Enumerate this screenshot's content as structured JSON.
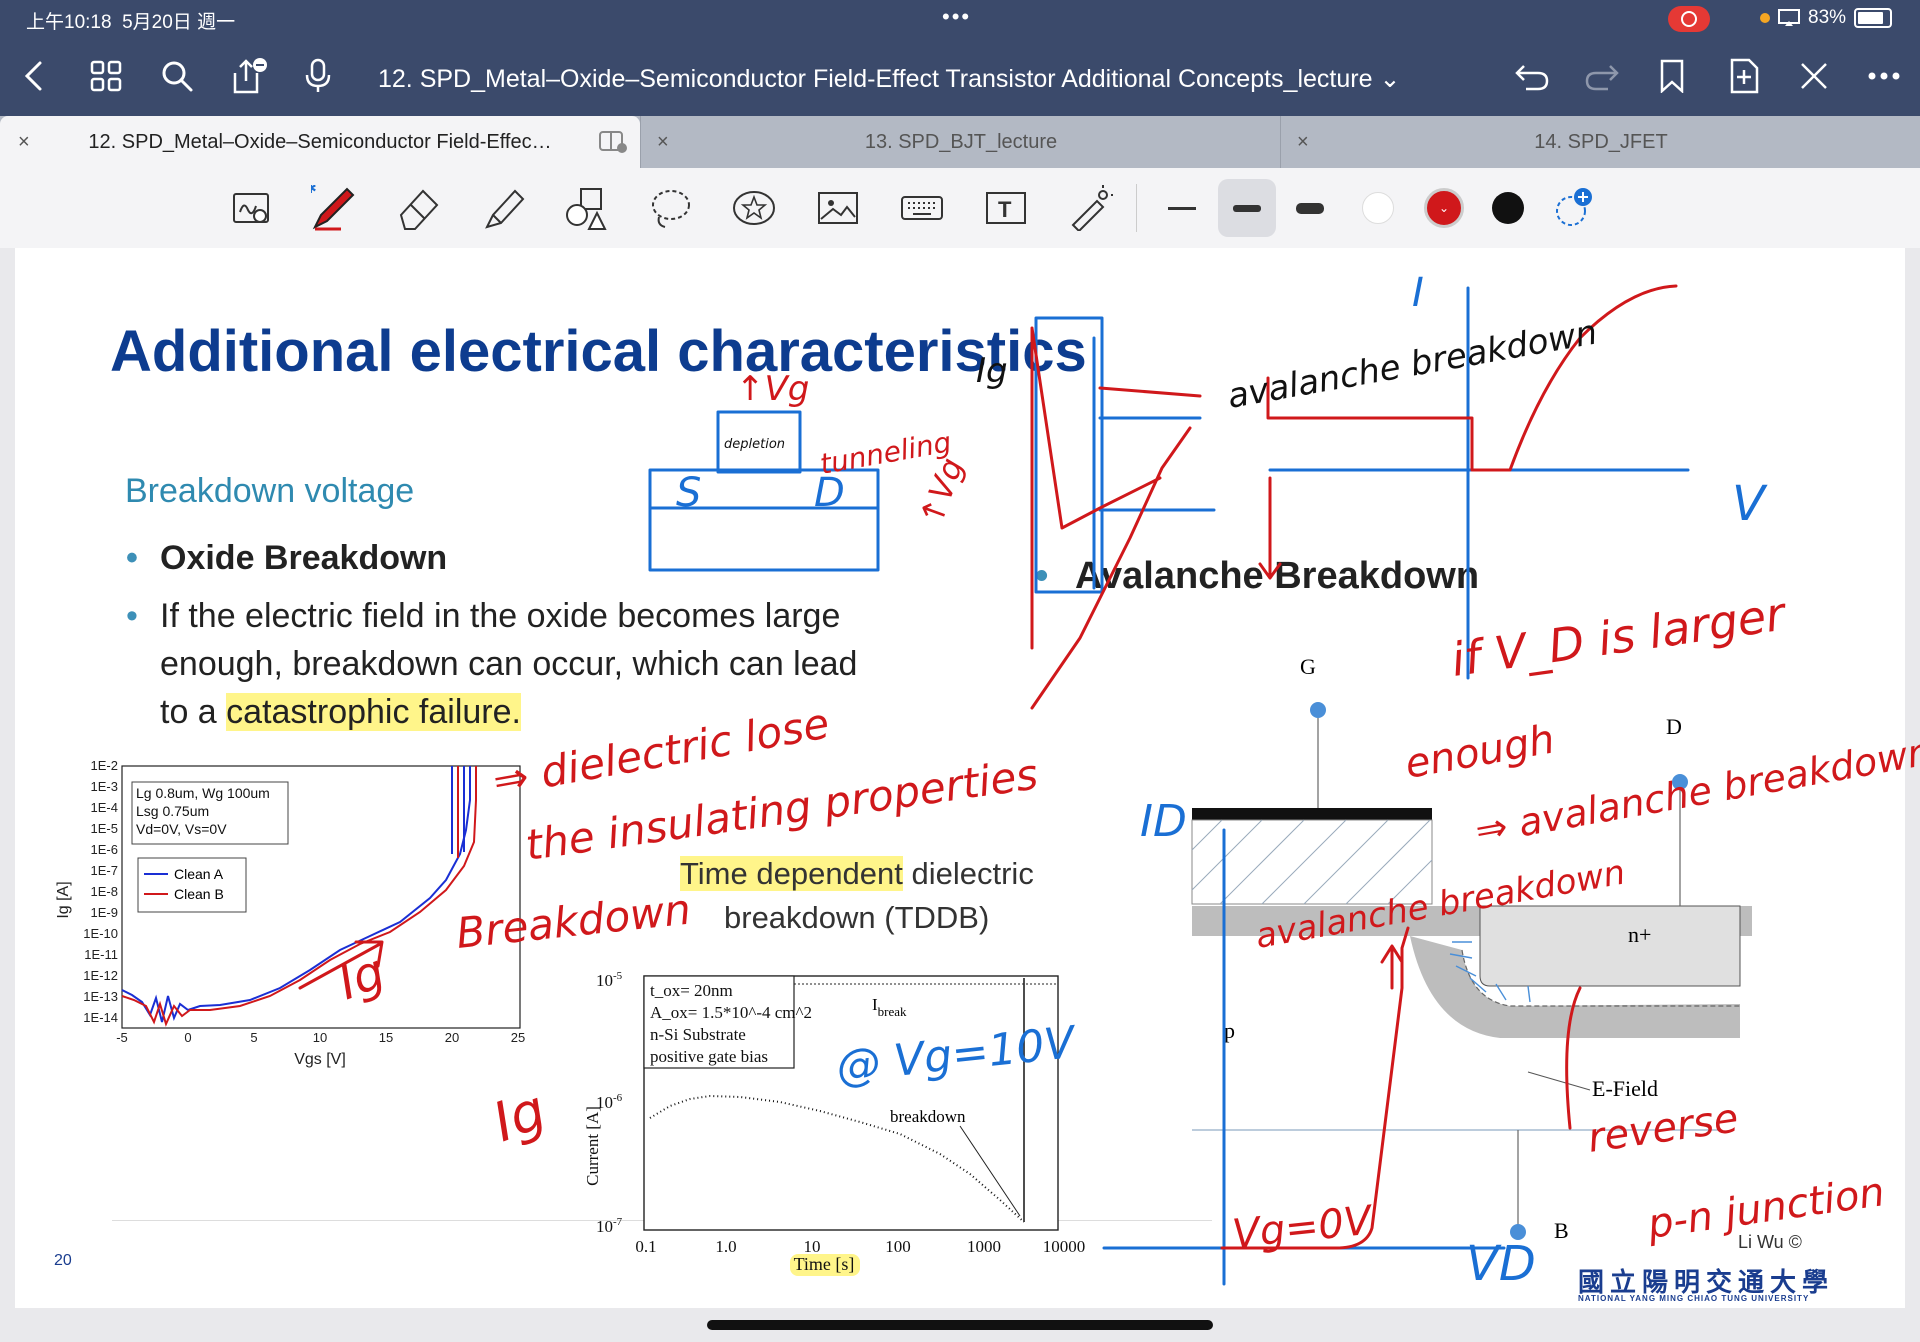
{
  "status": {
    "time": "上午10:18",
    "date": "5月20日 週一",
    "battery": "83%"
  },
  "nav": {
    "title": "12. SPD_Metal–Oxide–Semiconductor Field-Effect Transistor Additional Concepts_lecture ⌄"
  },
  "tabs": [
    {
      "label": "12. SPD_Metal–Oxide–Semiconductor Field-Effec…"
    },
    {
      "label": "13. SPD_BJT_lecture"
    },
    {
      "label": "14. SPD_JFET"
    }
  ],
  "colors": {
    "ink_red": "#d0181b",
    "ink_blue": "#1a6fd4",
    "title_blue": "#0d3c8f",
    "highlight": "#fff58a"
  },
  "slide": {
    "title": "Additional electrical characteristics",
    "subtitle": "Breakdown voltage",
    "bullet1": "Oxide Breakdown",
    "bullet2_a": "If the electric field in the oxide becomes large",
    "bullet2_b": "enough, breakdown can occur, which can lead",
    "bullet2_c": "to a ",
    "bullet2_hl": "catastrophic failure.",
    "bullet3": "Avalanche Breakdown",
    "tddb_hl": "Time dependent",
    "tddb_rest": " dielectric",
    "tddb_line2": "breakdown (TDDB)",
    "page_number": "20",
    "copyright": "Li Wu ©",
    "university": "國立陽明交通大學",
    "university_en": "NATIONAL YANG MING CHIAO TUNG UNIVERSITY"
  },
  "chart_left": {
    "legend_box": [
      "Lg 0.8um, Wg 100um",
      "Lsg 0.75um",
      "Vd=0V, Vs=0V"
    ],
    "series": [
      "Clean A",
      "Clean B"
    ],
    "ylabel": "Ig [A]",
    "xlabel": "Vgs [V]",
    "yticks": [
      "1E-2",
      "1E-3",
      "1E-4",
      "1E-5",
      "1E-6",
      "1E-7",
      "1E-8",
      "1E-9",
      "1E-10",
      "1E-11",
      "1E-12",
      "1E-13",
      "1E-14"
    ],
    "xticks": [
      "-5",
      "0",
      "5",
      "10",
      "15",
      "20",
      "25"
    ]
  },
  "chart_tddb": {
    "box": [
      "t_ox= 20nm",
      "A_ox= 1.5*10^-4 cm^2",
      "n-Si Substrate",
      "positive gate bias"
    ],
    "ibreak": "I",
    "ibreak_sub": "break",
    "breakdown_label": "breakdown",
    "ylabel": "Current [A]",
    "xlabel": "Time [s]",
    "yticks": [
      "10",
      "10",
      "10"
    ],
    "ytick_exp": [
      "-5",
      "-6",
      "-7"
    ],
    "xticks": [
      "0.1",
      "1.0",
      "10",
      "100",
      "1000",
      "10000"
    ]
  },
  "device": {
    "G": "G",
    "D": "D",
    "B": "B",
    "p": "p",
    "nplus": "n+",
    "efield": "E-Field"
  },
  "annotations": {
    "avalanche_breakdown": "avalanche breakdown",
    "if_vd": "if V_D is larger",
    "enough": "enough",
    "implies_avalanche": "⇒ avalanche breakdown",
    "dielectric": "⇒ dielectric lose",
    "insulating": "the insulating properties",
    "breakdown": "Breakdown",
    "reverse": "reverse",
    "pn_junction": "p-n junction",
    "vg0v": "Vg=0V",
    "vg10v": "@ Vg=10V",
    "tunneling": "tunneling",
    "tvg": "↑Vg",
    "ig": "Ig",
    "I": "I",
    "V": "V",
    "ID": "ID",
    "VD": "VD",
    "S": "S",
    "Dlbl": "D",
    "depletion": "depletion"
  }
}
